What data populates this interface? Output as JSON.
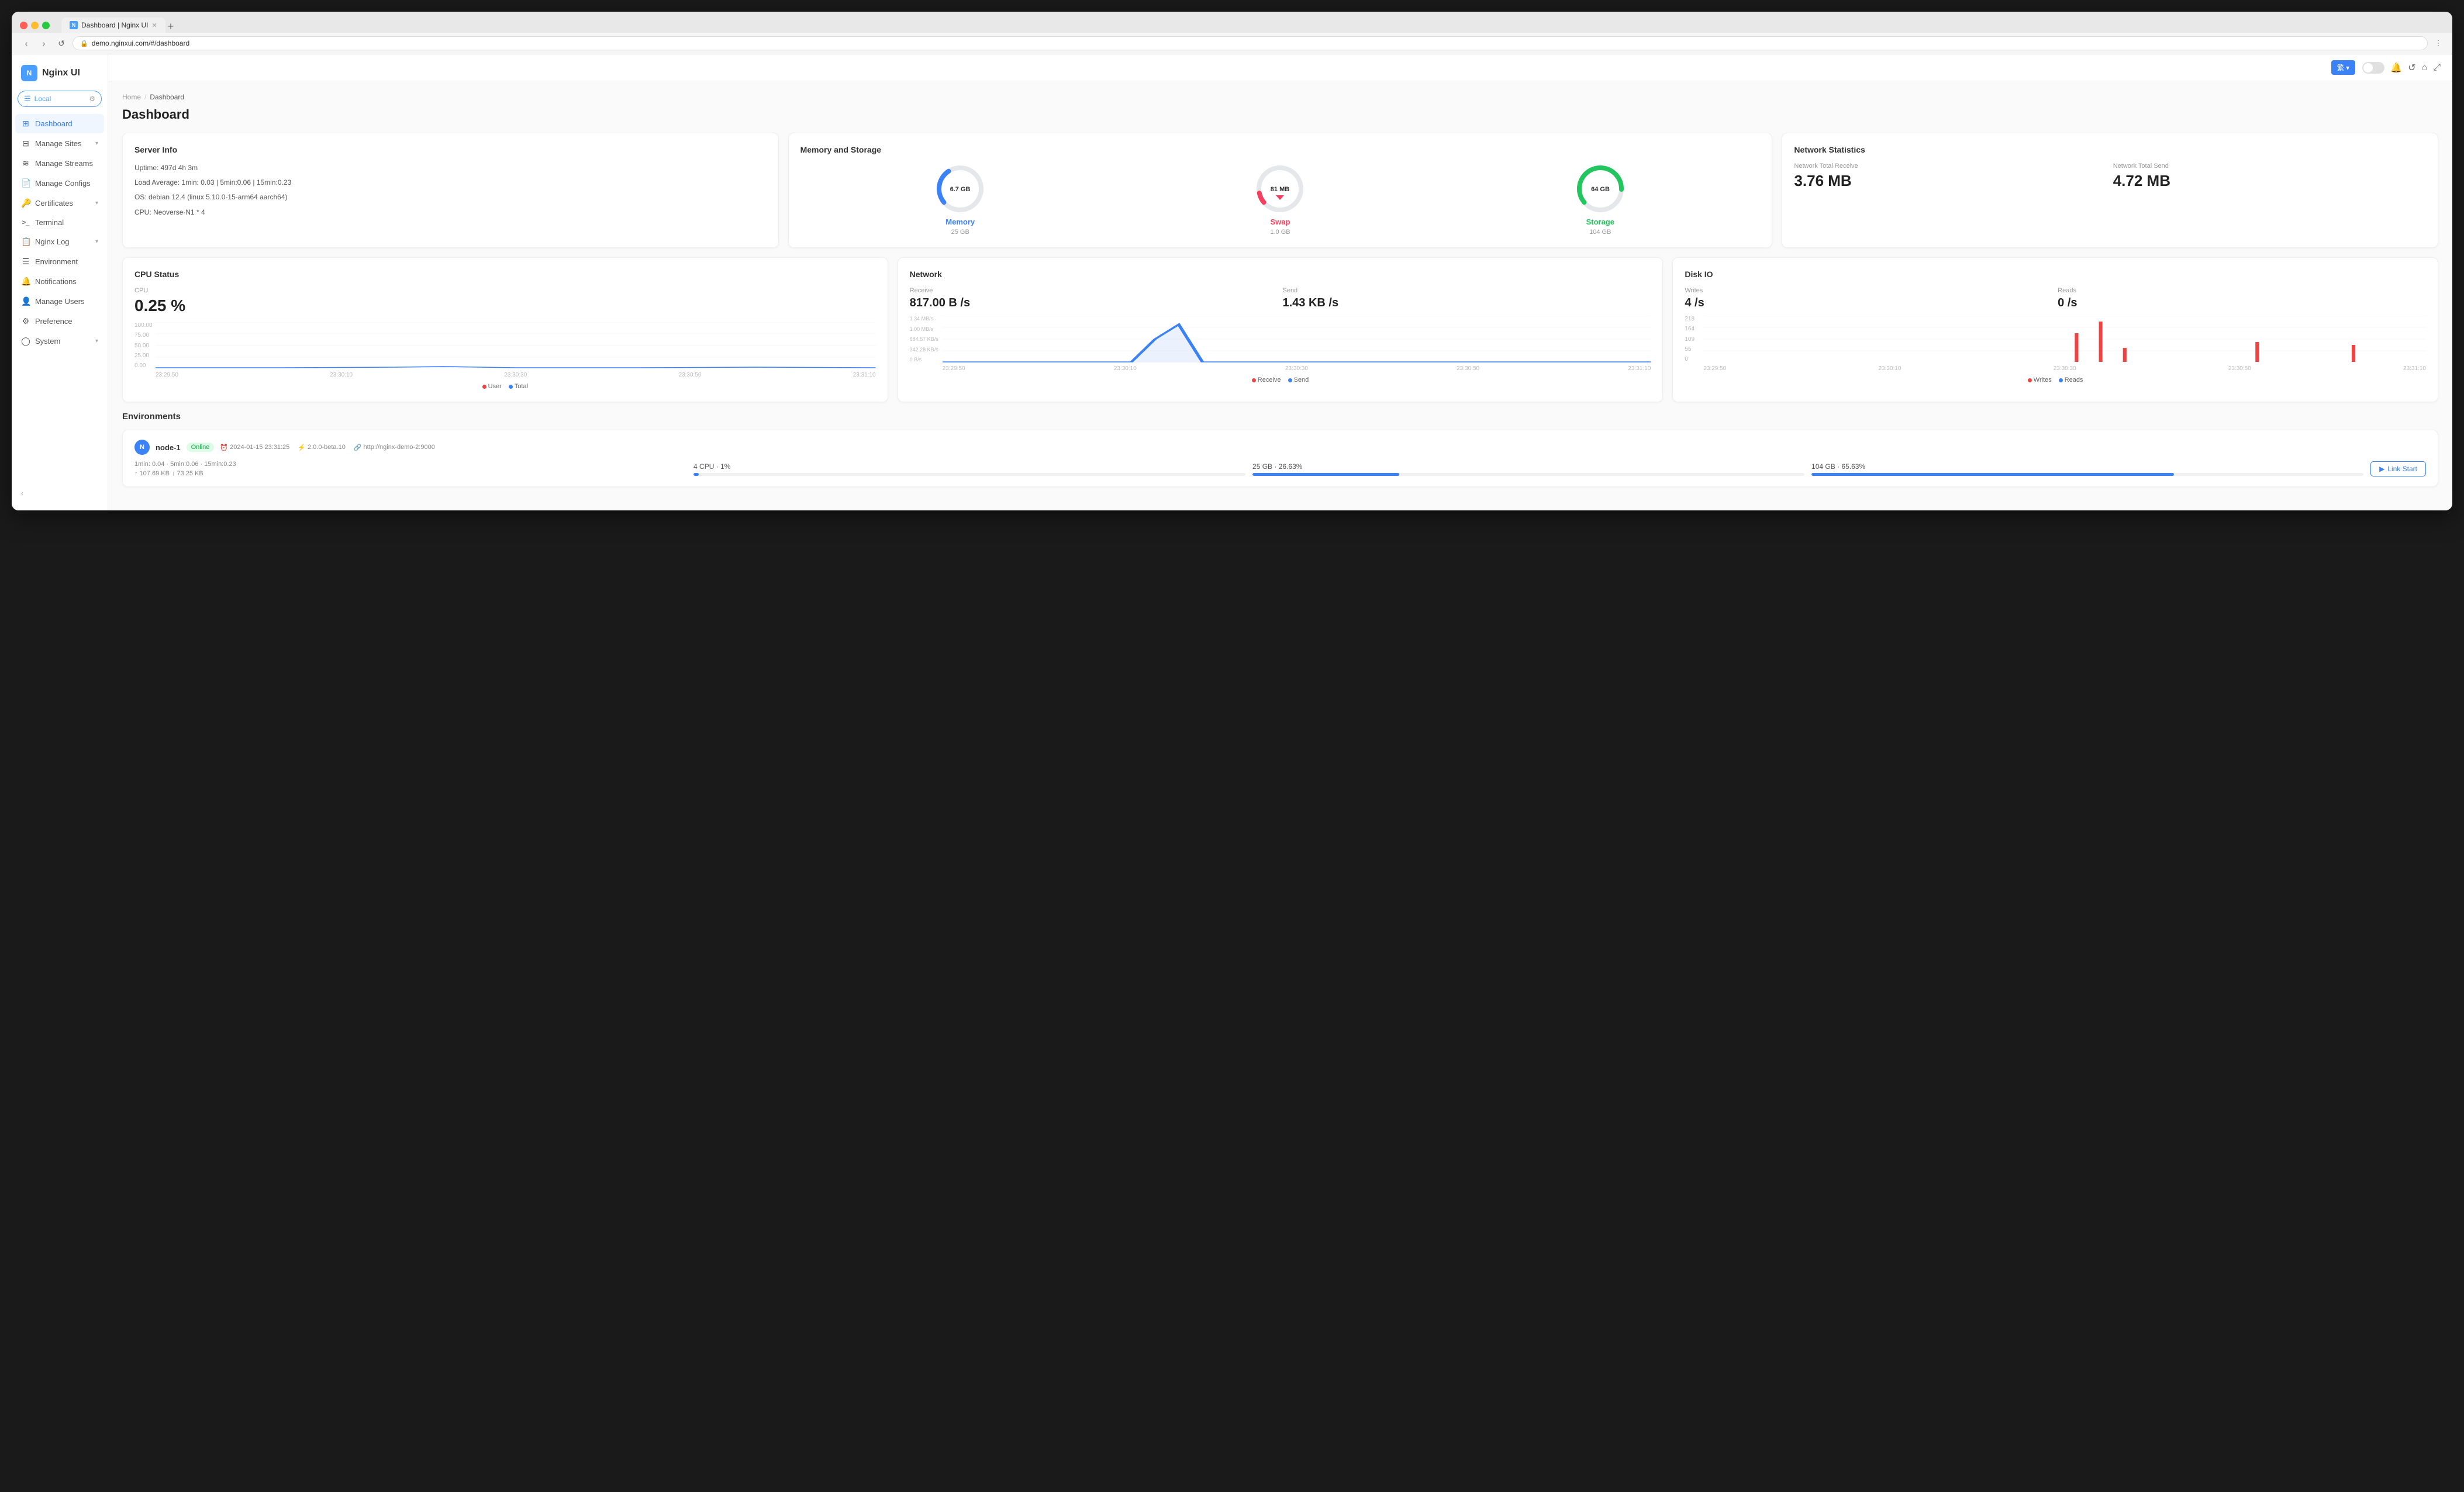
{
  "browser": {
    "tab_title": "Dashboard | Nginx UI",
    "tab_favicon": "N",
    "address": "demo.nginxui.com/#/dashboard",
    "new_tab_icon": "+"
  },
  "header": {
    "lang_label": "繁 ▾",
    "title": "Dashboard",
    "breadcrumb_home": "Home",
    "breadcrumb_sep": "/",
    "breadcrumb_current": "Dashboard",
    "page_title": "Dashboard"
  },
  "sidebar": {
    "logo": "Nginx UI",
    "logo_letter": "N",
    "env_label": "Local",
    "nav_items": [
      {
        "id": "dashboard",
        "label": "Dashboard",
        "icon": "⊞",
        "active": true
      },
      {
        "id": "manage-sites",
        "label": "Manage Sites",
        "icon": "☰",
        "has_chevron": true
      },
      {
        "id": "manage-streams",
        "label": "Manage Streams",
        "icon": "≋",
        "has_chevron": false
      },
      {
        "id": "manage-configs",
        "label": "Manage Configs",
        "icon": "📄",
        "has_chevron": false
      },
      {
        "id": "certificates",
        "label": "Certificates",
        "icon": "🔑",
        "has_chevron": true
      },
      {
        "id": "terminal",
        "label": "Terminal",
        "icon": ">_",
        "has_chevron": false
      },
      {
        "id": "nginx-log",
        "label": "Nginx Log",
        "icon": "📋",
        "has_chevron": true
      },
      {
        "id": "environment",
        "label": "Environment",
        "icon": "☰",
        "has_chevron": false
      },
      {
        "id": "notifications",
        "label": "Notifications",
        "icon": "🔔",
        "has_chevron": false
      },
      {
        "id": "manage-users",
        "label": "Manage Users",
        "icon": "👤",
        "has_chevron": false
      },
      {
        "id": "preference",
        "label": "Preference",
        "icon": "⚙",
        "has_chevron": false
      },
      {
        "id": "system",
        "label": "System",
        "icon": "◯",
        "has_chevron": true
      }
    ],
    "collapse_label": "‹"
  },
  "server_info": {
    "title": "Server Info",
    "uptime": "Uptime: 497d 4h 3m",
    "load_average": "Load Average: 1min: 0.03 | 5min:0.06 | 15min:0.23",
    "os": "OS: debian 12.4 (linux 5.10.0-15-arm64 aarch64)",
    "cpu": "CPU: Neoverse-N1 * 4"
  },
  "memory_storage": {
    "title": "Memory and Storage",
    "memory_value": "6.7 GB",
    "memory_label": "Memory",
    "memory_total": "25 GB",
    "memory_percent": 26.8,
    "swap_value": "81 MB",
    "swap_label": "Swap",
    "swap_total": "1.0 GB",
    "swap_percent": 8,
    "storage_value": "64 GB",
    "storage_label": "Storage",
    "storage_total": "104 GB",
    "storage_percent": 61.5
  },
  "network_stats": {
    "title": "Network Statistics",
    "receive_label": "Network Total Receive",
    "receive_value": "3.76 MB",
    "send_label": "Network Total Send",
    "send_value": "4.72 MB"
  },
  "cpu_status": {
    "title": "CPU Status",
    "label": "CPU",
    "value": "0.25 %",
    "y_labels": [
      "100.00",
      "75.00",
      "50.00",
      "25.00",
      "0.00"
    ],
    "x_labels": [
      "23:29:50",
      "23:30:10",
      "23:30:30",
      "23:30:50",
      "23:31:10"
    ],
    "legend": [
      {
        "color": "#ef4444",
        "label": "User"
      },
      {
        "color": "#3b82f6",
        "label": "Total"
      }
    ]
  },
  "network_io": {
    "title": "Network",
    "receive_label": "Receive",
    "receive_value": "817.00 B /s",
    "send_label": "Send",
    "send_value": "1.43 KB /s",
    "y_labels": [
      "1.34 MB/s",
      "1.00 MB/s",
      "684.57 KB/s",
      "342.28 KB/s",
      "0 B/s"
    ],
    "x_labels": [
      "23:29:50",
      "23:30:10",
      "23:30:30",
      "23:30:50",
      "23:31:10"
    ],
    "legend": [
      {
        "color": "#ef4444",
        "label": "Receive"
      },
      {
        "color": "#3b82f6",
        "label": "Send"
      }
    ]
  },
  "disk_io": {
    "title": "Disk IO",
    "writes_label": "Writes",
    "writes_value": "4 /s",
    "reads_label": "Reads",
    "reads_value": "0 /s",
    "y_labels": [
      "218",
      "164",
      "109",
      "55",
      "0"
    ],
    "x_labels": [
      "23:29:50",
      "23:30:10",
      "23:30:30",
      "23:30:50",
      "23:31:10"
    ],
    "legend": [
      {
        "color": "#ef4444",
        "label": "Writes"
      },
      {
        "color": "#3b82f6",
        "label": "Reads"
      }
    ]
  },
  "environments": {
    "title": "Environments",
    "node": {
      "icon": "N",
      "name": "node-1",
      "status": "Online",
      "timestamp": "2024-01-15 23:31:25",
      "version": "2.0.0-beta.10",
      "url": "http://nginx-demo-2:9000",
      "load": "1min: 0.04 · 5min:0.06 · 15min:0.23",
      "upload": "107.69 KB",
      "download": "73.25 KB",
      "cpu_label": "4 CPU · 1%",
      "cpu_bar": 1,
      "memory_label": "25 GB · 26.63%",
      "memory_bar": 26.63,
      "storage_label": "104 GB · 65.63%",
      "storage_bar": 65.63,
      "link_btn": "Link Start"
    }
  }
}
